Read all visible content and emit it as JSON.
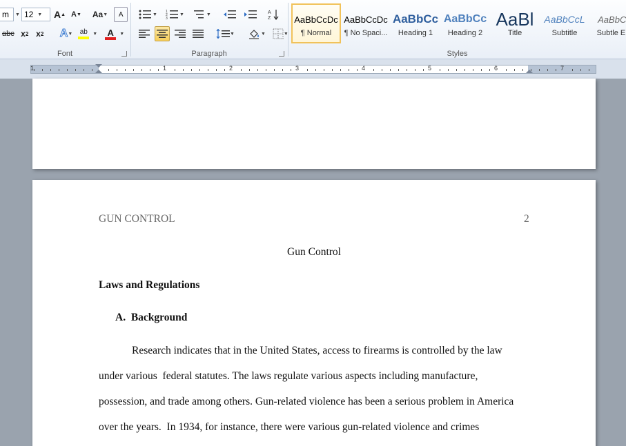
{
  "ribbon": {
    "font": {
      "font_name": "m",
      "font_size": "12",
      "grow": "A",
      "shrink": "A",
      "change_case": "Aa",
      "clear": "A",
      "strike": "abc",
      "subscript": "x",
      "sub_mark": "2",
      "superscript": "x",
      "sup_mark": "2",
      "text_effects": "A",
      "highlight": "ab",
      "font_color": "A",
      "label": "Font"
    },
    "paragraph": {
      "label": "Paragraph",
      "pilcrow": "¶"
    },
    "styles": {
      "label": "Styles",
      "items": [
        {
          "sample": "AaBbCcDc",
          "name": "¶ Normal"
        },
        {
          "sample": "AaBbCcDc",
          "name": "¶ No Spaci..."
        },
        {
          "sample": "AaBbCc",
          "name": "Heading 1"
        },
        {
          "sample": "AaBbCc",
          "name": "Heading 2"
        },
        {
          "sample": "AaBl",
          "name": "Title"
        },
        {
          "sample": "AaBbCcL",
          "name": "Subtitle"
        },
        {
          "sample": "AaBbCc",
          "name": "Subtle Em"
        }
      ],
      "selected_index": 0
    },
    "colors": {
      "highlight": "#ffff00",
      "font_color": "#e02020",
      "accent": "#2b6cc4"
    }
  },
  "ruler": {
    "numbers": [
      "1",
      "1",
      "2",
      "3",
      "4",
      "5",
      "6",
      "7"
    ]
  },
  "document": {
    "header_left": "GUN CONTROL",
    "header_right": "2",
    "title": "Gun Control",
    "heading1": "Laws and Regulations",
    "heading2": "A.  Background",
    "paragraph_lines": [
      "Research indicates that in the United States, access to firearms is controlled by the law",
      "under various  federal statutes. The laws regulate various aspects including manufacture,",
      "possession, and trade among others. Gun-related violence has been a serious problem in America",
      "over the years.  In 1934, for instance, there were various gun-related violence and crimes"
    ]
  }
}
